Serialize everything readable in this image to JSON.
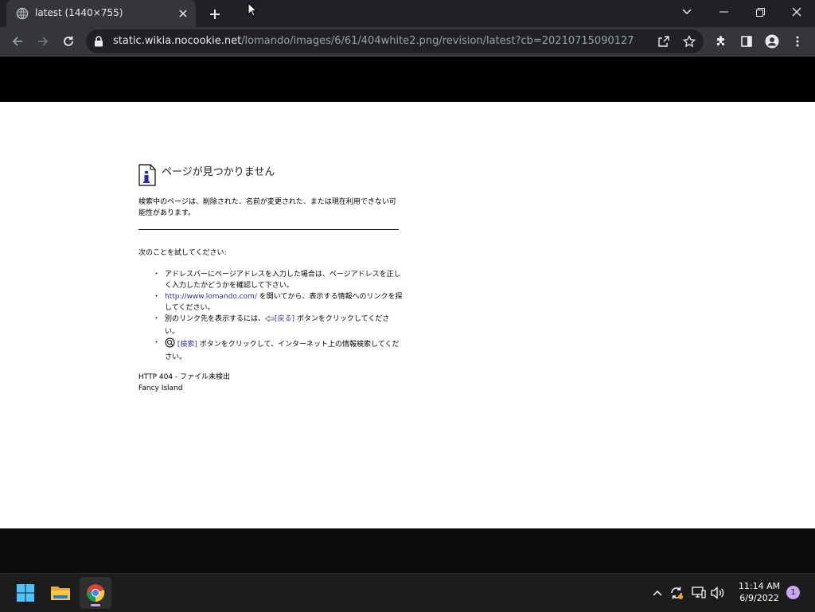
{
  "browser": {
    "tab": {
      "title": "latest (1440×755)"
    },
    "address": {
      "host": "static.wikia.nocookie.net",
      "path": "/lomando/images/6/61/404white2.png/revision/latest?cb=20210715090127"
    }
  },
  "error_page": {
    "heading": "ページが見つかりません",
    "description": "検索中のページは、削除された、名前が変更された、または現在利用できない可能性があります。",
    "try_label": "次のことを試してください:",
    "items": {
      "item1": "アドレスバーにページアドレスを入力した場合は、ページアドレスを正しく入力したかどうかを確認して下さい。",
      "item2_link": "http://www.lomando.com/",
      "item2_rest": " を開いてから、表示する情報へのリンクを探してください。",
      "item3_pre": "別のリンク先を表示するには、",
      "item3_link": "[戻る]",
      "item3_post": " ボタンをクリックしてください。",
      "item4_link": "[検索]",
      "item4_post": " ボタンをクリックして、インターネット上の情報検索してください。"
    },
    "footer_code": "HTTP 404 - ファイル未検出",
    "footer_site": "Fancy Island"
  },
  "taskbar": {
    "time": "11:14 AM",
    "date": "6/9/2022",
    "notification_count": "1"
  }
}
